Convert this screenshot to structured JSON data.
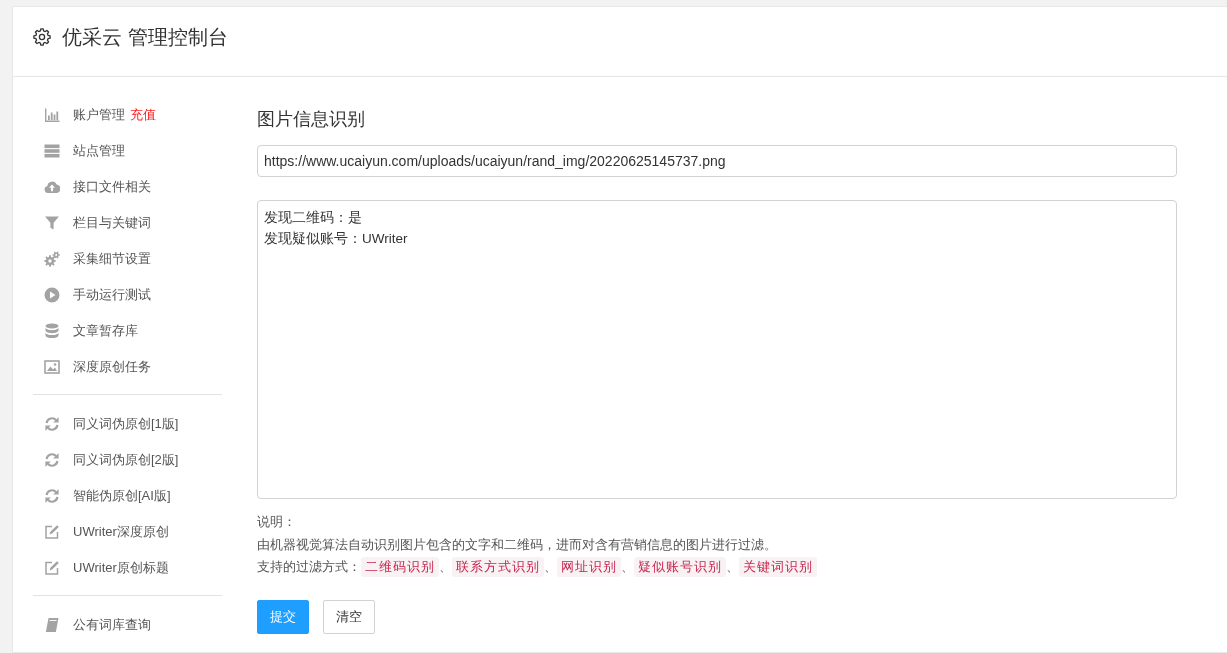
{
  "header": {
    "title": "优采云 管理控制台"
  },
  "sidebar": {
    "groups": [
      {
        "items": [
          {
            "kind": "chart",
            "label": "账户管理",
            "badge": "充值"
          },
          {
            "kind": "server",
            "label": "站点管理"
          },
          {
            "kind": "upload",
            "label": "接口文件相关"
          },
          {
            "kind": "filter",
            "label": "栏目与关键词"
          },
          {
            "kind": "gears",
            "label": "采集细节设置"
          },
          {
            "kind": "play",
            "label": "手动运行测试"
          },
          {
            "kind": "database",
            "label": "文章暂存库"
          },
          {
            "kind": "image",
            "label": "深度原创任务"
          }
        ]
      },
      {
        "items": [
          {
            "kind": "refresh",
            "label": "同义词伪原创[1版]"
          },
          {
            "kind": "refresh",
            "label": "同义词伪原创[2版]"
          },
          {
            "kind": "refresh",
            "label": "智能伪原创[AI版]"
          },
          {
            "kind": "edit",
            "label": "UWriter深度原创"
          },
          {
            "kind": "edit",
            "label": "UWriter原创标题"
          }
        ]
      },
      {
        "items": [
          {
            "kind": "book",
            "label": "公有词库查询"
          }
        ]
      }
    ]
  },
  "main": {
    "title": "图片信息识别",
    "url_field": {
      "value": "https://www.ucaiyun.com/uploads/ucaiyun/rand_img/20220625145737.png"
    },
    "result_field": {
      "lines": [
        "发现二维码：是",
        "发现疑似账号：UWriter"
      ]
    },
    "notes": {
      "heading": "说明：",
      "description": "由机器视觉算法自动识别图片包含的文字和二维码，进而对含有营销信息的图片进行过滤。",
      "filters_label": "支持的过滤方式：",
      "filters": [
        {
          "label": "二维码识别",
          "separator": "、"
        },
        {
          "label": "联系方式识别",
          "separator": "、"
        },
        {
          "label": "网址识别",
          "separator": "、"
        },
        {
          "label": "疑似账号识别",
          "separator": "、"
        },
        {
          "label": "关键词识别"
        }
      ]
    },
    "buttons": [
      {
        "label": "提交",
        "kind": "primary"
      },
      {
        "label": "清空",
        "kind": "default"
      }
    ]
  }
}
